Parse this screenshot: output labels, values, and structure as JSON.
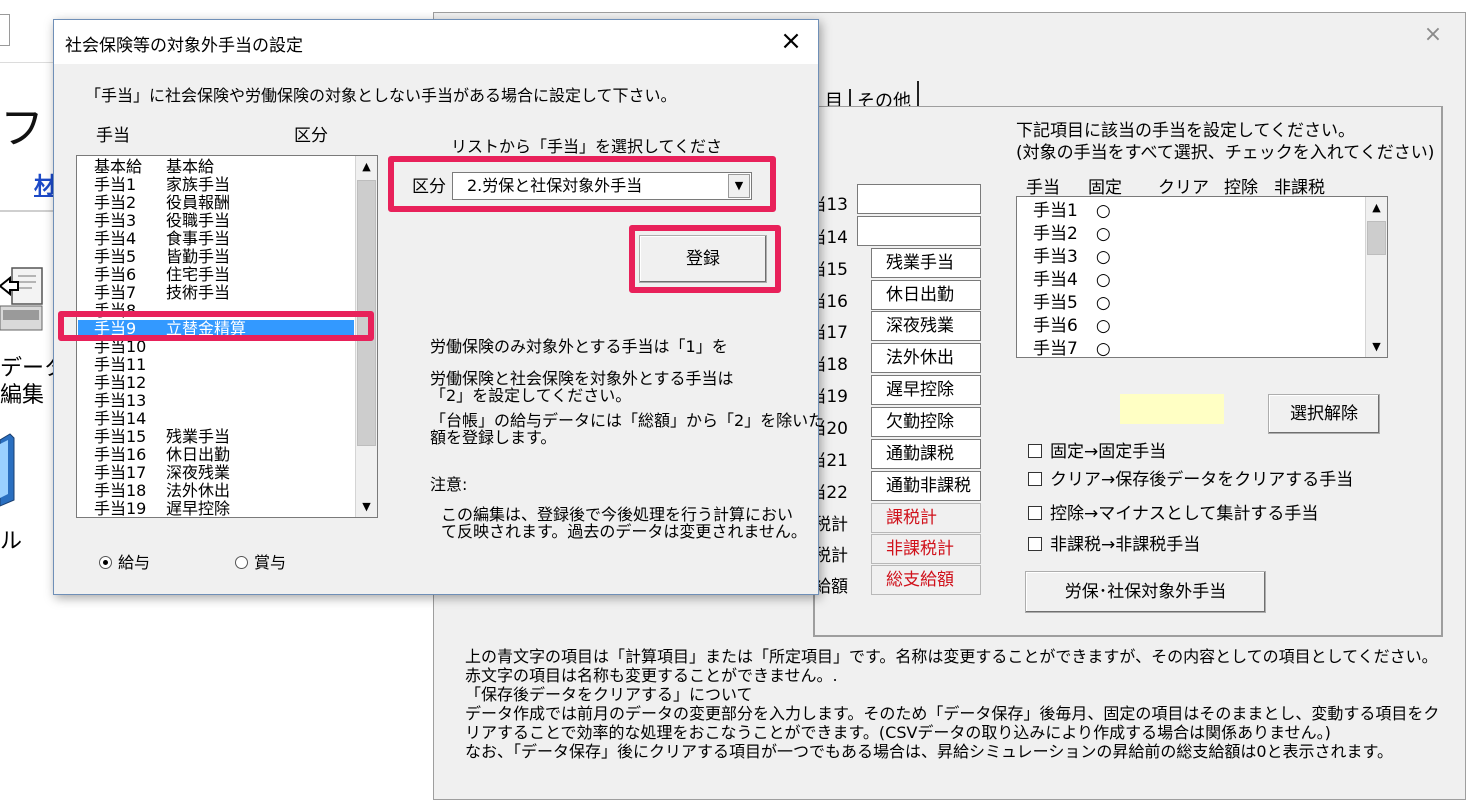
{
  "background_app": {
    "left_big_chars": "フ",
    "left_link_label": "材",
    "left_label_1": "データ",
    "left_label_2": "編集",
    "left_label_3": "ル",
    "tabs": [
      "目",
      "その他"
    ],
    "rows": [
      {
        "label": "当13",
        "value": ""
      },
      {
        "label": "当14",
        "value": ""
      },
      {
        "label": "当15",
        "value": "残業手当"
      },
      {
        "label": "当16",
        "value": "休日出勤"
      },
      {
        "label": "当17",
        "value": "深夜残業"
      },
      {
        "label": "当18",
        "value": "法外休出"
      },
      {
        "label": "当19",
        "value": "遅早控除"
      },
      {
        "label": "当20",
        "value": "欠勤控除"
      },
      {
        "label": "当21",
        "value": "通勤課税"
      },
      {
        "label": "当22",
        "value": "通勤非課税"
      },
      {
        "label": "税計",
        "value": "課税計"
      },
      {
        "label": "税計",
        "value": "非課税計"
      },
      {
        "label": "給額",
        "value": "総支給額"
      }
    ],
    "right_info_1": "下記項目に該当の手当を設定してください。",
    "right_info_2": "(対象の手当をすべて選択、チェックを入れてください)",
    "mini_headers": [
      "手当",
      "固定",
      "クリア",
      "控除",
      "非課税"
    ],
    "mini_items": [
      {
        "name": "手当1",
        "mark": "○"
      },
      {
        "name": "手当2",
        "mark": "○"
      },
      {
        "name": "手当3",
        "mark": "○"
      },
      {
        "name": "手当4",
        "mark": "○"
      },
      {
        "name": "手当5",
        "mark": "○"
      },
      {
        "name": "手当6",
        "mark": "○"
      },
      {
        "name": "手当7",
        "mark": "○"
      }
    ],
    "deselect_button": "選択解除",
    "checkboxes": [
      "固定→固定手当",
      "クリア→保存後データをクリアする手当",
      "控除→マイナスとして集計する手当",
      "非課税→非課税手当"
    ],
    "exempt_button": "労保･社保対象外手当",
    "bottom_notes": [
      "上の青文字の項目は「計算項目」または「所定項目」です。名称は変更することができますが、その内容としての項目としてください。",
      "赤文字の項目は名称も変更することができません。.",
      "「保存後データをクリアする」について",
      "データ作成では前月のデータの変更部分を入力します。そのため「データ保存」後毎月、固定の項目はそのままとし、変動する項目をク",
      "リアすることで効率的な処理をおこなうことができます。(CSVデータの取り込みにより作成する場合は関係ありません。)",
      "なお、「データ保存」後にクリアする項目が一つでもある場合は、昇給シミュレーションの昇給前の総支給額は0と表示されます。"
    ],
    "close_glyph": "×"
  },
  "dialog": {
    "title": "社会保険等の対象外手当の設定",
    "close_glyph": "×",
    "instruction": "「手当」に社会保険や労働保険の対象としない手当がある場合に設定して下さい。",
    "col_header_1": "手当",
    "col_header_2": "区分",
    "list_items": [
      {
        "name": "基本給",
        "kubun": "基本給"
      },
      {
        "name": "手当1",
        "kubun": "家族手当"
      },
      {
        "name": "手当2",
        "kubun": "役員報酬"
      },
      {
        "name": "手当3",
        "kubun": "役職手当"
      },
      {
        "name": "手当4",
        "kubun": "食事手当"
      },
      {
        "name": "手当5",
        "kubun": "皆勤手当"
      },
      {
        "name": "手当6",
        "kubun": "住宅手当"
      },
      {
        "name": "手当7",
        "kubun": "技術手当"
      },
      {
        "name": "手当8",
        "kubun": ""
      },
      {
        "name": "手当9",
        "kubun": "立替金精算"
      },
      {
        "name": "手当10",
        "kubun": ""
      },
      {
        "name": "手当11",
        "kubun": ""
      },
      {
        "name": "手当12",
        "kubun": ""
      },
      {
        "name": "手当13",
        "kubun": ""
      },
      {
        "name": "手当14",
        "kubun": ""
      },
      {
        "name": "手当15",
        "kubun": "残業手当"
      },
      {
        "name": "手当16",
        "kubun": "休日出勤"
      },
      {
        "name": "手当17",
        "kubun": "深夜残業"
      },
      {
        "name": "手当18",
        "kubun": "法外休出"
      },
      {
        "name": "手当19",
        "kubun": "遅早控除"
      }
    ],
    "selected_index": 9,
    "select_prompt": "リストから「手当」を選択してくださ",
    "kubun_label": "区分",
    "kubun_value": "2.労保と社保対象外手当",
    "register_button": "登録",
    "note_1": "労働保険のみ対象外とする手当は「1」を",
    "note_2a": "労働保険と社会保険を対象外とする手当は",
    "note_2b": "「2」を設定してください。",
    "note_3a": "「台帳」の給与データには「総額」から「2」を除いた",
    "note_3b": "額を登録します。",
    "caution_label": "注意:",
    "caution_1": "この編集は、登録後で今後処理を行う計算におい",
    "caution_2": "て反映されます。過去のデータは変更されません。",
    "radio_salary": "給与",
    "radio_bonus": "賞与",
    "radio_selected": "給与"
  },
  "colors": {
    "highlight": "#e8215a",
    "selection": "#3399ff",
    "red_text": "#d0101a",
    "link_blue": "#1c49c7"
  }
}
